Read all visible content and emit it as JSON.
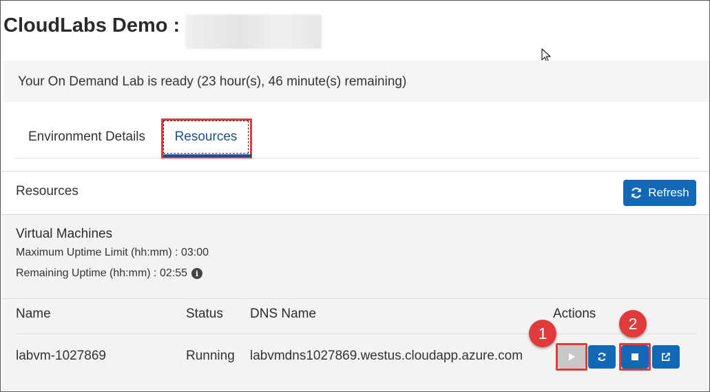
{
  "header": {
    "title": "CloudLabs Demo :"
  },
  "lab_status": {
    "message": "Your On Demand Lab is ready (23 hour(s), 46 minute(s) remaining)"
  },
  "tabs": [
    {
      "label": "Environment Details",
      "active": false
    },
    {
      "label": "Resources",
      "active": true
    }
  ],
  "resources_panel": {
    "title": "Resources",
    "refresh_label": "Refresh"
  },
  "virtual_machines": {
    "heading": "Virtual Machines",
    "max_uptime": "Maximum Uptime Limit (hh:mm) : 03:00",
    "remaining_uptime": "Remaining Uptime (hh:mm) : 02:55",
    "columns": [
      "Name",
      "Status",
      "DNS Name",
      "Actions"
    ],
    "rows": [
      {
        "name": "labvm-1027869",
        "status": "Running",
        "dns": "labvmdns1027869.westus.cloudapp.azure.com",
        "actions": [
          "start-icon",
          "restart-icon",
          "stop-icon",
          "open-external-icon"
        ]
      }
    ]
  },
  "annotations": {
    "marker_1": "1",
    "marker_2": "2"
  },
  "colors": {
    "primary": "#1168b5",
    "tab_active": "#1f4e8c",
    "highlight": "#e03a3a",
    "disabled_button": "#c8c8c8"
  }
}
